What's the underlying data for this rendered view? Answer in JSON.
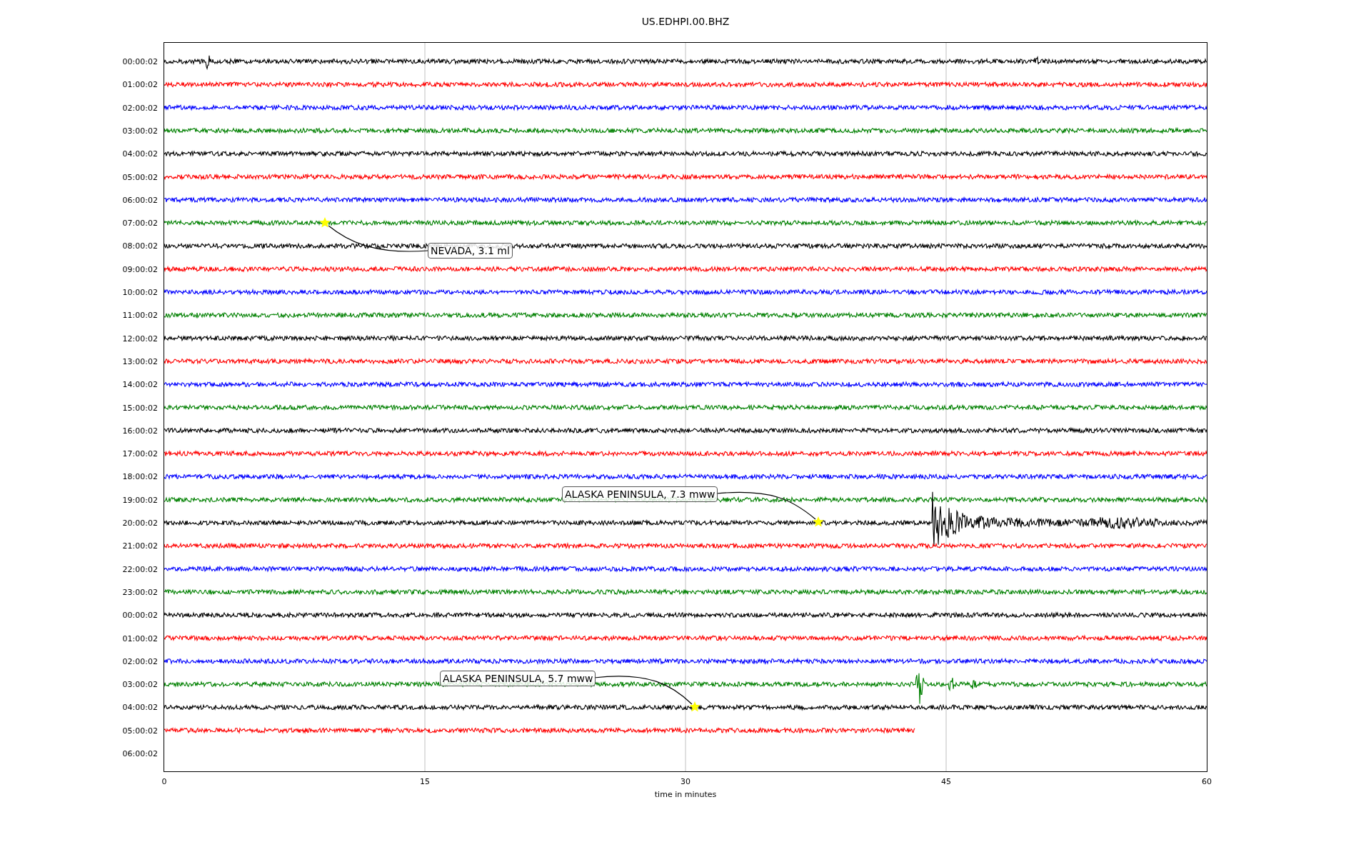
{
  "figure": {
    "title": "US.EDHPI.00.BHZ"
  },
  "plot": {
    "rows": [
      {
        "label": "00:00:02",
        "color": "#000000",
        "level": 1
      },
      {
        "label": "01:00:02",
        "color": "#ff0000",
        "level": 1
      },
      {
        "label": "02:00:02",
        "color": "#0000ff",
        "level": 1
      },
      {
        "label": "03:00:02",
        "color": "#008000",
        "level": 1
      },
      {
        "label": "04:00:02",
        "color": "#000000",
        "level": 1
      },
      {
        "label": "05:00:02",
        "color": "#ff0000",
        "level": 1
      },
      {
        "label": "06:00:02",
        "color": "#0000ff",
        "level": 1
      },
      {
        "label": "07:00:02",
        "color": "#008000",
        "level": 1
      },
      {
        "label": "08:00:02",
        "color": "#000000",
        "level": 1
      },
      {
        "label": "09:00:02",
        "color": "#ff0000",
        "level": 1
      },
      {
        "label": "10:00:02",
        "color": "#0000ff",
        "level": 1
      },
      {
        "label": "11:00:02",
        "color": "#008000",
        "level": 1
      },
      {
        "label": "12:00:02",
        "color": "#000000",
        "level": 1
      },
      {
        "label": "13:00:02",
        "color": "#ff0000",
        "level": 1
      },
      {
        "label": "14:00:02",
        "color": "#0000ff",
        "level": 1
      },
      {
        "label": "15:00:02",
        "color": "#008000",
        "level": 1
      },
      {
        "label": "16:00:02",
        "color": "#000000",
        "level": 1
      },
      {
        "label": "17:00:02",
        "color": "#ff0000",
        "level": 1
      },
      {
        "label": "18:00:02",
        "color": "#0000ff",
        "level": 1
      },
      {
        "label": "19:00:02",
        "color": "#008000",
        "level": 1
      },
      {
        "label": "20:00:02",
        "color": "#000000",
        "level": 1
      },
      {
        "label": "21:00:02",
        "color": "#ff0000",
        "level": 1
      },
      {
        "label": "22:00:02",
        "color": "#0000ff",
        "level": 1
      },
      {
        "label": "23:00:02",
        "color": "#008000",
        "level": 1
      },
      {
        "label": "00:00:02",
        "color": "#000000",
        "level": 1
      },
      {
        "label": "01:00:02",
        "color": "#ff0000",
        "level": 1
      },
      {
        "label": "02:00:02",
        "color": "#0000ff",
        "level": 1
      },
      {
        "label": "03:00:02",
        "color": "#008000",
        "level": 1
      },
      {
        "label": "04:00:02",
        "color": "#000000",
        "level": 1
      },
      {
        "label": "05:00:02",
        "color": "#ff0000",
        "level": 0.72
      },
      {
        "label": "06:00:02"
      }
    ],
    "xticks": [
      "0",
      "15",
      "30",
      "45",
      "60"
    ],
    "xlabel": "time in minutes",
    "events": [
      {
        "label": "NEVADA, 3.1 ml"
      },
      {
        "label": "ALASKA PENINSULA, 7.3 mww"
      },
      {
        "label": "ALASKA PENINSULA, 5.7 mww"
      }
    ]
  }
}
